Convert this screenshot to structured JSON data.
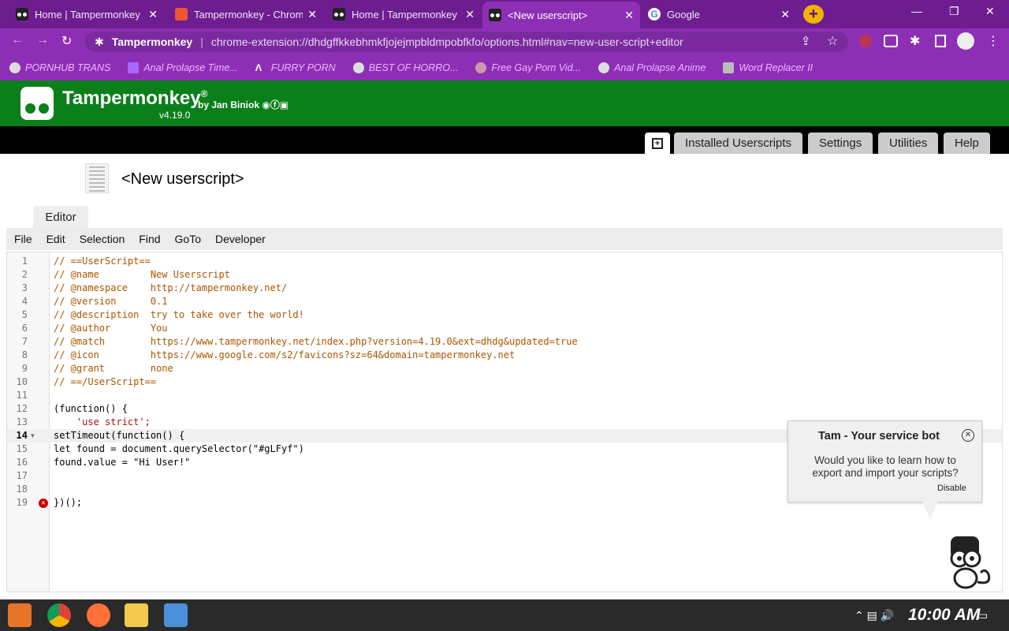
{
  "browser": {
    "tabs": [
      {
        "title": "Home | Tampermonkey",
        "icon": "tampermonkey-icon",
        "active": false
      },
      {
        "title": "Tampermonkey - Chrome",
        "icon": "chrome-webstore-icon",
        "active": false
      },
      {
        "title": "Home | Tampermonkey",
        "icon": "tampermonkey-icon",
        "active": false
      },
      {
        "title": "<New userscript>",
        "icon": "tampermonkey-icon",
        "active": true
      },
      {
        "title": "Google",
        "icon": "google-icon",
        "active": false
      }
    ],
    "omnibox": {
      "site": "Tampermonkey",
      "url": "chrome-extension://dhdgffkkebhmkfjojejmpbldmpobfkfo/options.html#nav=new-user-script+editor"
    },
    "bookmarks": [
      "PORNHUB TRANS",
      "Anal Prolapse Time...",
      "FURRY PORN",
      "BEST OF HORRO...",
      "Free Gay Porn Vid...",
      "Anal Prolapse Anime",
      "Word Replacer II"
    ]
  },
  "app": {
    "name": "Tampermonkey",
    "registered": "®",
    "by": "by Jan Biniok",
    "version": "v4.19.0",
    "nav": [
      "Installed Userscripts",
      "Settings",
      "Utilities",
      "Help"
    ],
    "script_title": "<New userscript>",
    "editor_tab": "Editor",
    "editor_menu": [
      "File",
      "Edit",
      "Selection",
      "Find",
      "GoTo",
      "Developer"
    ]
  },
  "code_lines": [
    "// ==UserScript==",
    "// @name         New Userscript",
    "// @namespace    http://tampermonkey.net/",
    "// @version      0.1",
    "// @description  try to take over the world!",
    "// @author       You",
    "// @match        https://www.tampermonkey.net/index.php?version=4.19.0&ext=dhdg&updated=true",
    "// @icon         https://www.google.com/s2/favicons?sz=64&domain=tampermonkey.net",
    "// @grant        none",
    "// ==/UserScript==",
    "",
    "(function() {",
    "    'use strict';",
    "setTimeout(function() {",
    "let found = document.querySelector(\"#gLFyf\")",
    "found.value = \"Hi User!\"",
    "",
    "",
    "})();"
  ],
  "service_bot": {
    "title": "Tam - Your service bot",
    "message": "Would you like to learn how to export and import your scripts?",
    "disable": "Disable"
  },
  "taskbar": {
    "clock": "10:00 AM"
  },
  "colors": {
    "tabstrip": "#6d1d8f",
    "toolbar": "#8d2fb5",
    "tm_green": "#0a7f1a",
    "error": "#cc0000"
  }
}
